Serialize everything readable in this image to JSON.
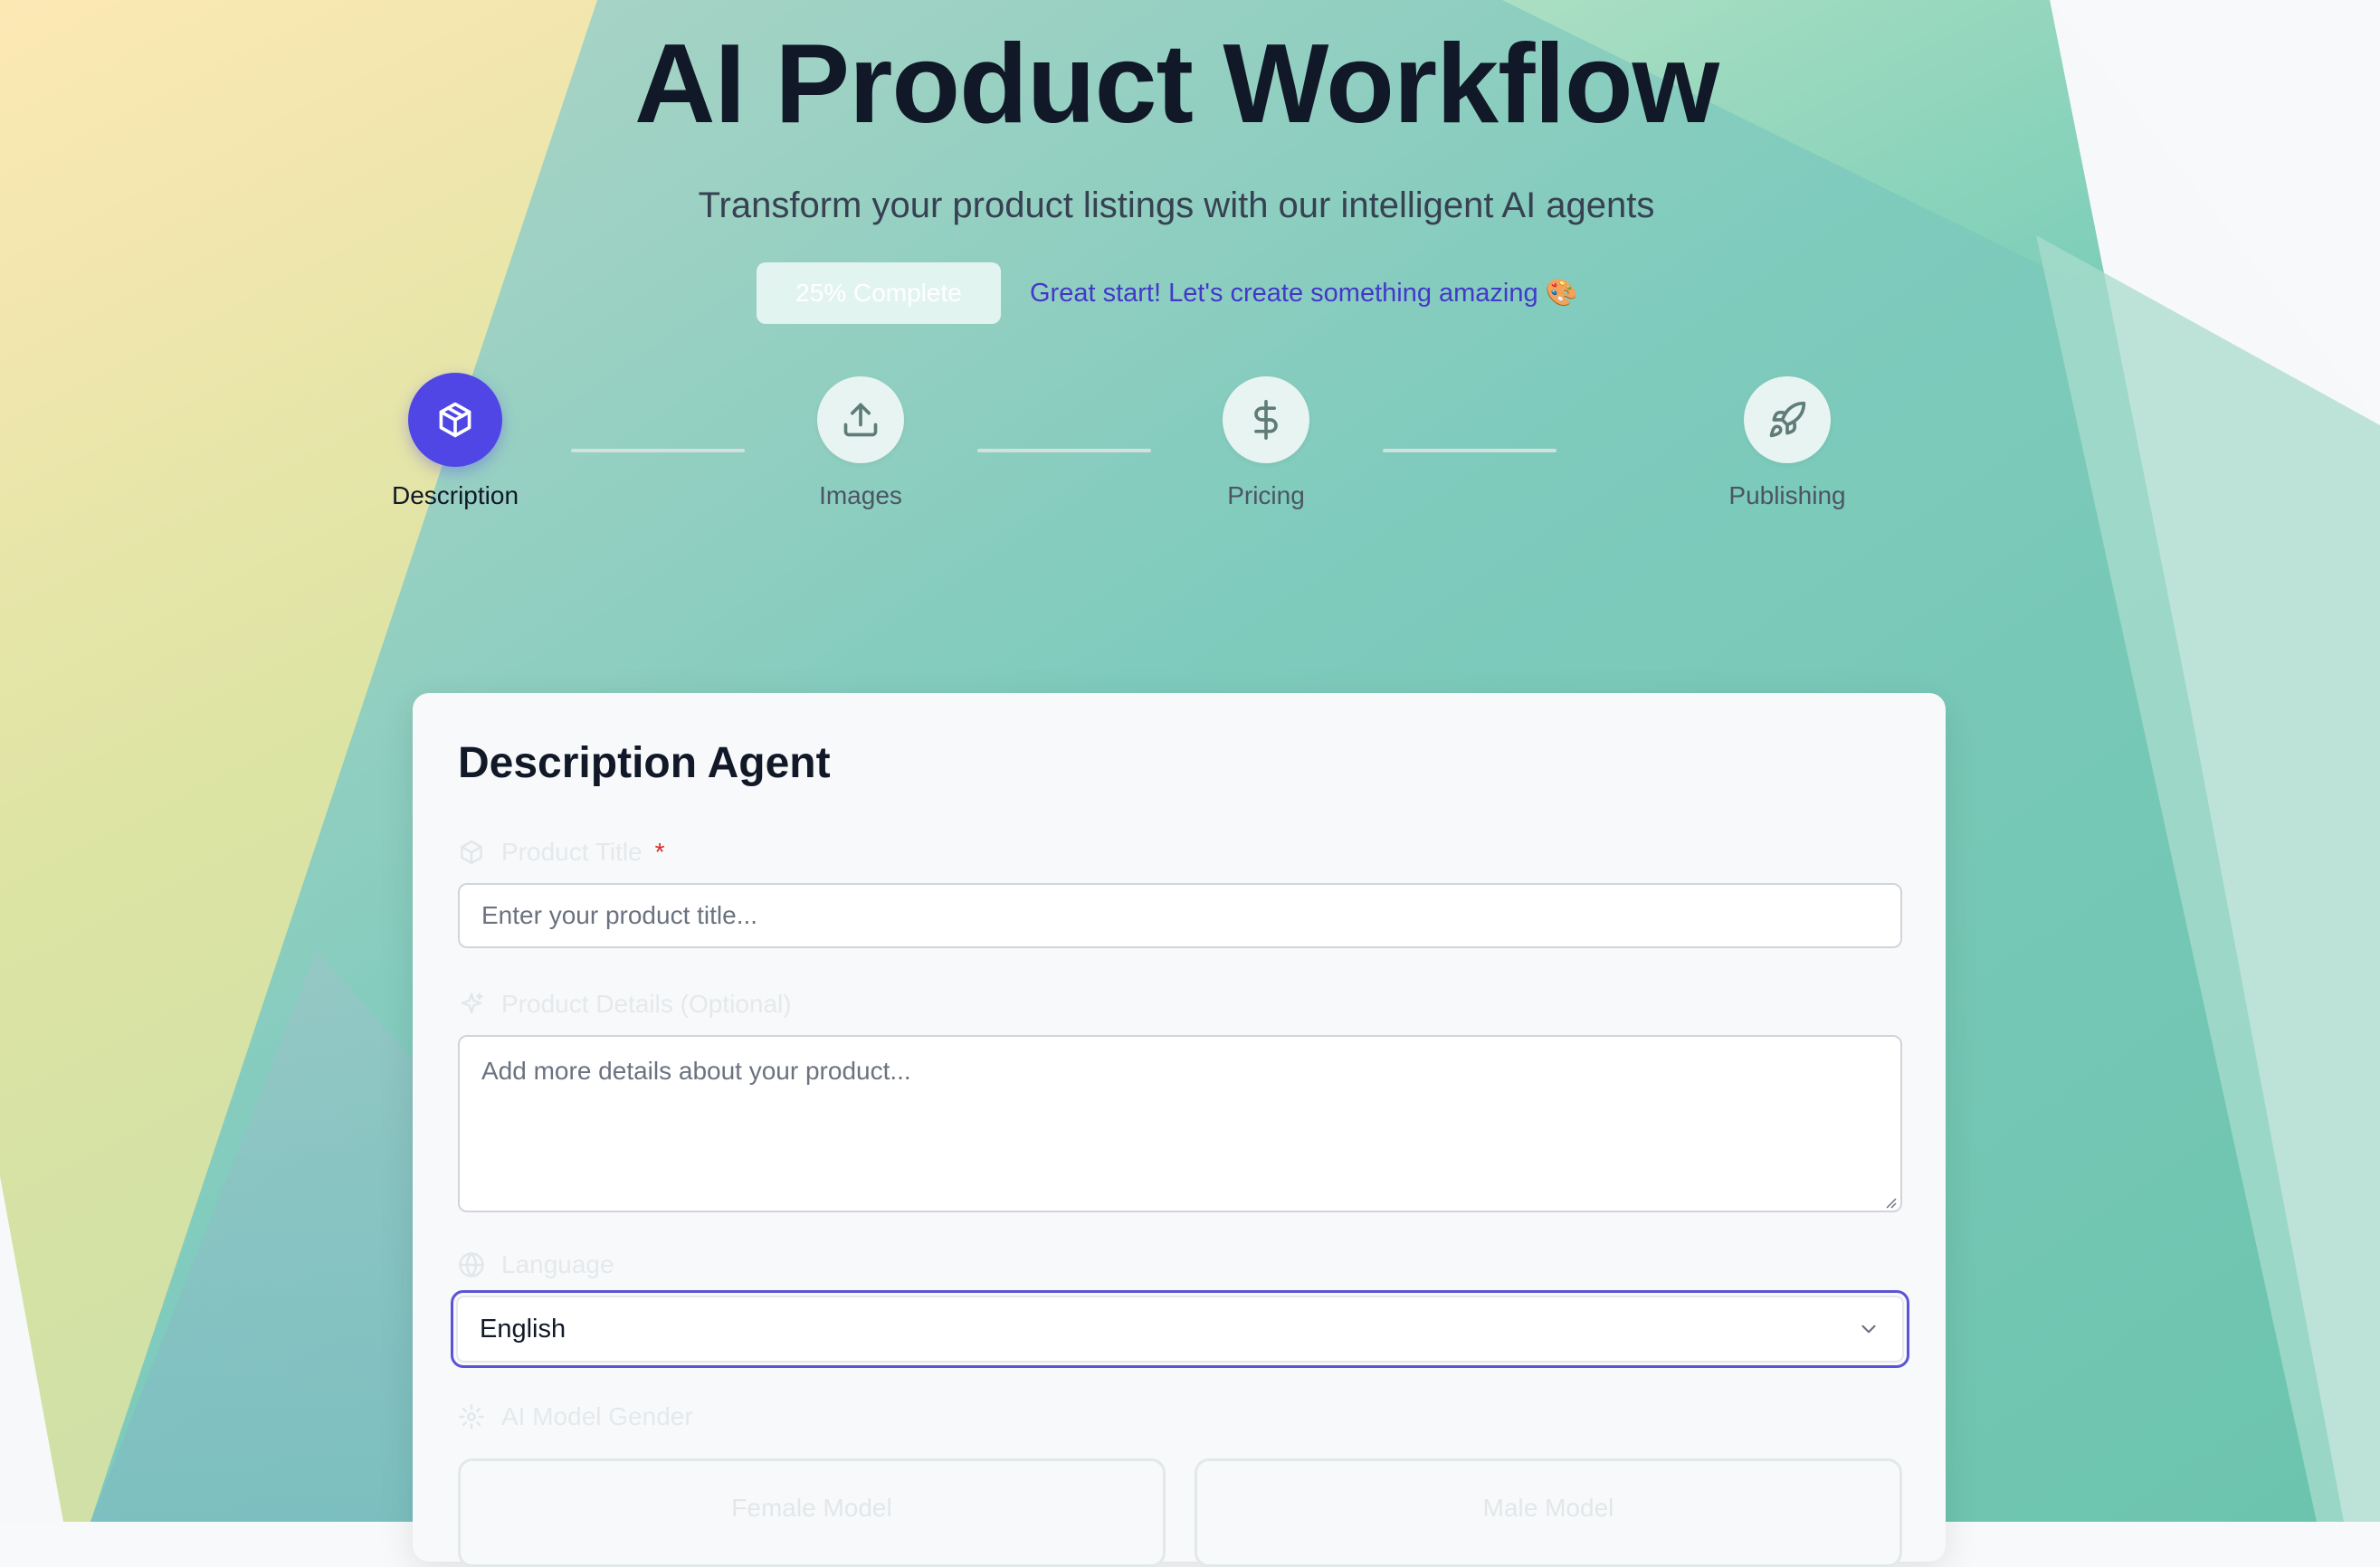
{
  "header": {
    "title": "AI Product Workflow",
    "subtitle": "Transform your product listings with our intelligent AI agents"
  },
  "progress": {
    "badge": "25% Complete",
    "percent": 25,
    "message": "Great start! Let's create something amazing 🎨"
  },
  "steps": [
    {
      "label": "Description",
      "icon": "package-icon",
      "active": true
    },
    {
      "label": "Images",
      "icon": "upload-icon",
      "active": false
    },
    {
      "label": "Pricing",
      "icon": "dollar-icon",
      "active": false
    },
    {
      "label": "Publishing",
      "icon": "rocket-icon",
      "active": false
    }
  ],
  "form": {
    "title": "Description Agent",
    "product_title": {
      "label": "Product Title",
      "required_mark": "*",
      "placeholder": "Enter your product title...",
      "value": ""
    },
    "product_details": {
      "label": "Product Details (Optional)",
      "placeholder": "Add more details about your product...",
      "value": ""
    },
    "language": {
      "label": "Language",
      "selected": "English"
    },
    "gender": {
      "label": "AI Model Gender",
      "options": [
        "Female Model",
        "Male Model"
      ]
    }
  },
  "colors": {
    "accent": "#4f46e5",
    "focus_ring": "#5b54d8",
    "required": "#dc2626",
    "progress_message": "#4338ca"
  }
}
